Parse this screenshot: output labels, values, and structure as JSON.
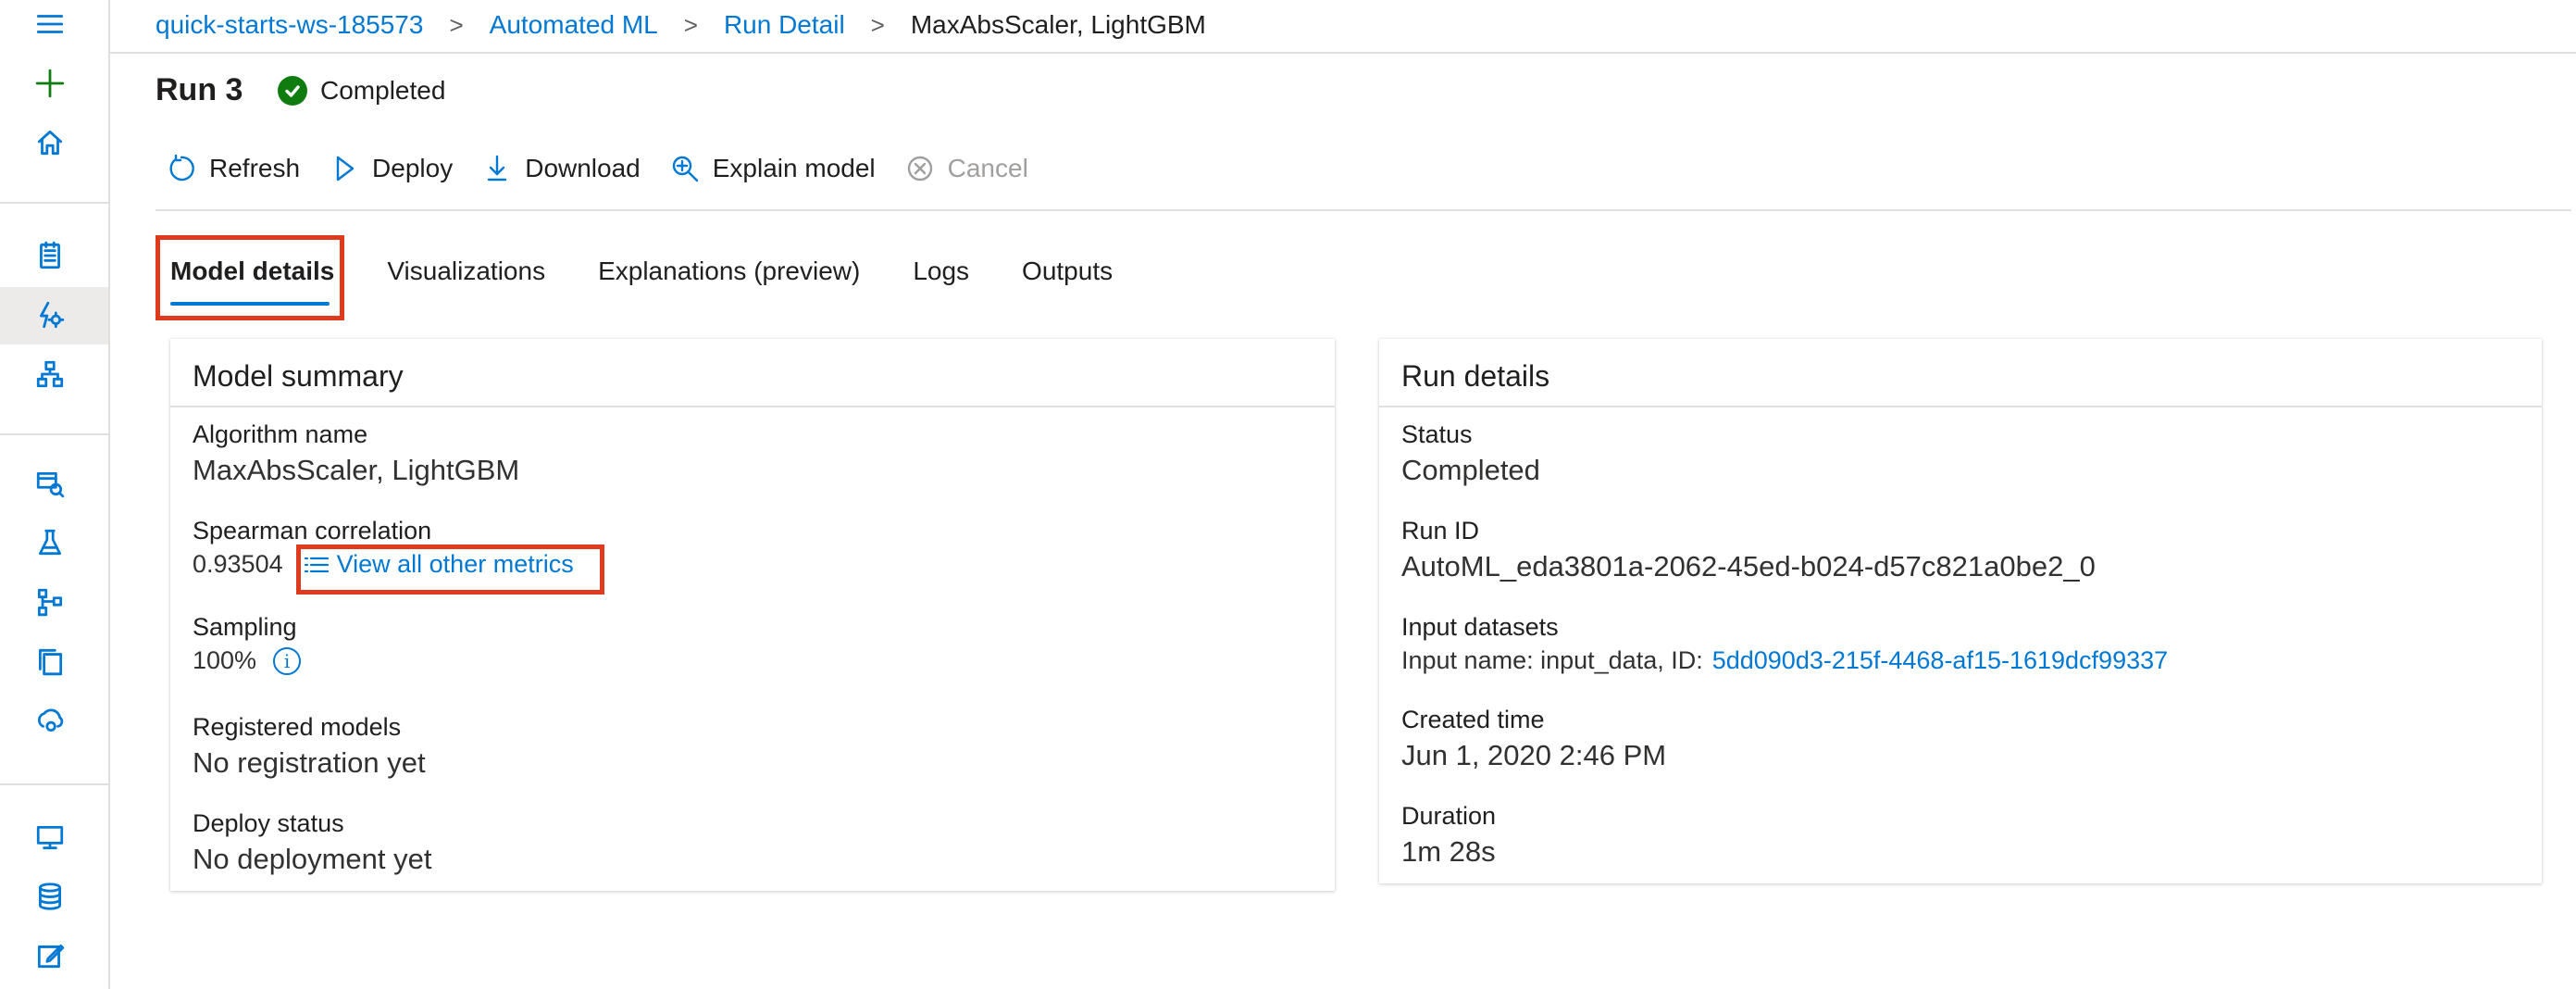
{
  "breadcrumb": {
    "workspace": "quick-starts-ws-185573",
    "section": "Automated ML",
    "page": "Run Detail",
    "current": "MaxAbsScaler, LightGBM"
  },
  "run": {
    "title": "Run 3",
    "status": "Completed"
  },
  "toolbar": {
    "refresh": "Refresh",
    "deploy": "Deploy",
    "download": "Download",
    "explain": "Explain model",
    "cancel": "Cancel"
  },
  "tabs": [
    {
      "label": "Model details",
      "active": true
    },
    {
      "label": "Visualizations",
      "active": false
    },
    {
      "label": "Explanations (preview)",
      "active": false
    },
    {
      "label": "Logs",
      "active": false
    },
    {
      "label": "Outputs",
      "active": false
    }
  ],
  "model_summary": {
    "title": "Model summary",
    "algorithm_label": "Algorithm name",
    "algorithm_value": "MaxAbsScaler, LightGBM",
    "metric_label": "Spearman correlation",
    "metric_value": "0.93504",
    "metrics_link": "View all other metrics",
    "sampling_label": "Sampling",
    "sampling_value": "100%",
    "registered_label": "Registered models",
    "registered_value": "No registration yet",
    "deploy_label": "Deploy status",
    "deploy_value": "No deployment yet"
  },
  "run_details": {
    "title": "Run details",
    "status_label": "Status",
    "status_value": "Completed",
    "runid_label": "Run ID",
    "runid_value": "AutoML_eda3801a-2062-45ed-b024-d57c821a0be2_0",
    "datasets_label": "Input datasets",
    "datasets_prefix": "Input name: input_data, ID:",
    "datasets_id": "5dd090d3-215f-4468-af15-1619dcf99337",
    "created_label": "Created time",
    "created_value": "Jun 1, 2020 2:46 PM",
    "duration_label": "Duration",
    "duration_value": "1m 28s"
  },
  "colors": {
    "accent": "#0078d4",
    "success": "#107c10",
    "highlight": "#e03a1e"
  }
}
